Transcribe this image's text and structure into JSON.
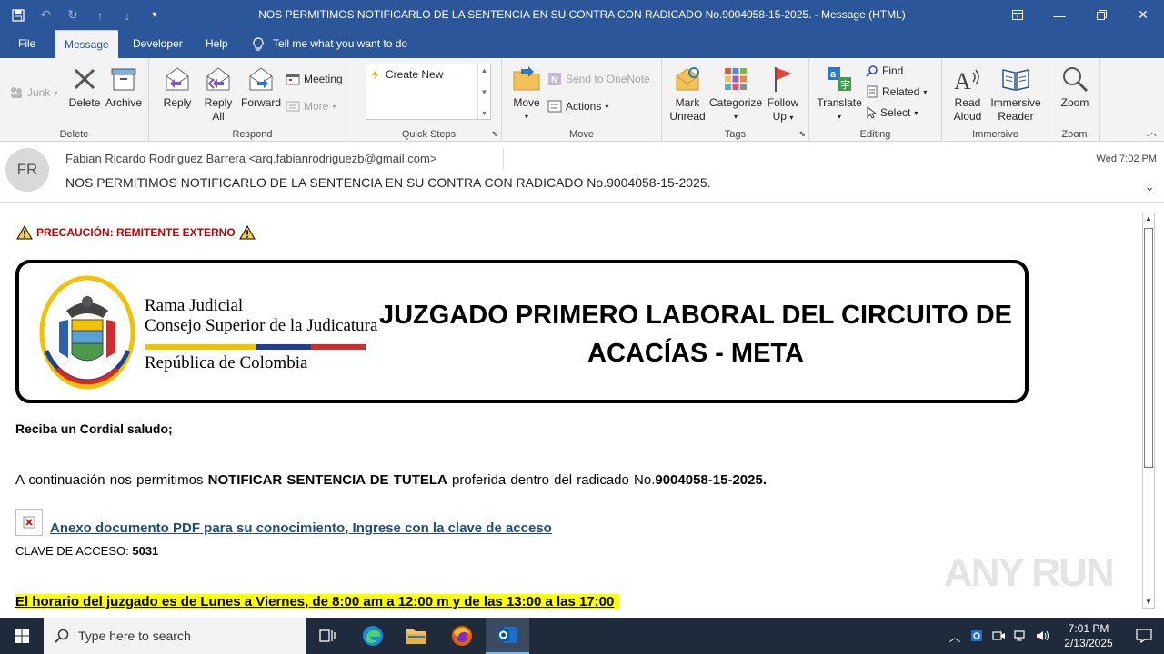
{
  "window": {
    "title": "NOS PERMITIMOS NOTIFICARLO DE LA SENTENCIA EN SU CONTRA CON RADICADO No.9004058-15-2025.  -  Message (HTML)"
  },
  "tabs": [
    {
      "label": "File"
    },
    {
      "label": "Message"
    },
    {
      "label": "Developer"
    },
    {
      "label": "Help"
    }
  ],
  "tell_me": "Tell me what you want to do",
  "ribbon": {
    "delete_group": {
      "label": "Delete",
      "junk": "Junk",
      "delete": "Delete",
      "archive": "Archive"
    },
    "respond_group": {
      "label": "Respond",
      "reply": "Reply",
      "reply_all_1": "Reply",
      "reply_all_2": "All",
      "forward": "Forward",
      "meeting": "Meeting",
      "more": "More"
    },
    "quick_steps_group": {
      "label": "Quick Steps",
      "create_new": "Create New"
    },
    "move_group": {
      "label": "Move",
      "move": "Move",
      "send_to_onenote": "Send to OneNote",
      "actions": "Actions"
    },
    "tags_group": {
      "label": "Tags",
      "mark_unread_1": "Mark",
      "mark_unread_2": "Unread",
      "categorize": "Categorize",
      "follow_up_1": "Follow",
      "follow_up_2": "Up"
    },
    "editing_group": {
      "label": "Editing",
      "translate": "Translate",
      "find": "Find",
      "related": "Related",
      "select": "Select"
    },
    "immersive_group": {
      "label": "Immersive",
      "read_aloud_1": "Read",
      "read_aloud_2": "Aloud",
      "immersive_reader_1": "Immersive",
      "immersive_reader_2": "Reader"
    },
    "zoom_group": {
      "label": "Zoom",
      "zoom": "Zoom"
    }
  },
  "header": {
    "avatar_initials": "FR",
    "sender": "Fabian Ricardo Rodriguez Barrera <arq.fabianrodriguezb@gmail.com>",
    "subject": "NOS PERMITIMOS NOTIFICARLO DE LA SENTENCIA EN SU CONTRA CON RADICADO No.9004058-15-2025.",
    "date": "Wed 7:02 PM"
  },
  "body": {
    "warning": "PRECAUCIÓN: REMITENTE EXTERNO",
    "banner": {
      "line1": "Rama Judicial",
      "line2": "Consejo Superior de la Judicatura",
      "line3": "República de Colombia",
      "court_1": "JUZGADO PRIMERO LABORAL DEL CIRCUITO DE",
      "court_2": "ACACÍAS - META"
    },
    "greeting": "Reciba un Cordial saludo;",
    "intro_pre": "A continuación nos permitimos ",
    "intro_bold": "NOTIFICAR SENTENCIA DE TUTELA",
    "intro_mid": " proferida dentro  del radicado No.",
    "intro_number": "9004058-15-2025.",
    "attachment_link": "Anexo documento PDF para su conocimiento, Ingrese con la clave de acceso",
    "clave_label": "CLAVE DE ACCESO: ",
    "clave_value": "5031",
    "hours": "El horario del juzgado es de Lunes a Viernes, de 8:00 am a 12:00 m y de las 13:00 a  las 17:00"
  },
  "watermark": "ANY RUN",
  "taskbar": {
    "search_placeholder": "Type here to search",
    "time": "7:01 PM",
    "date": "2/13/2025"
  },
  "colors": {
    "accent": "#2b579a",
    "warning": "#c00000",
    "highlight": "#ffff00",
    "link": "#1f4e79"
  }
}
